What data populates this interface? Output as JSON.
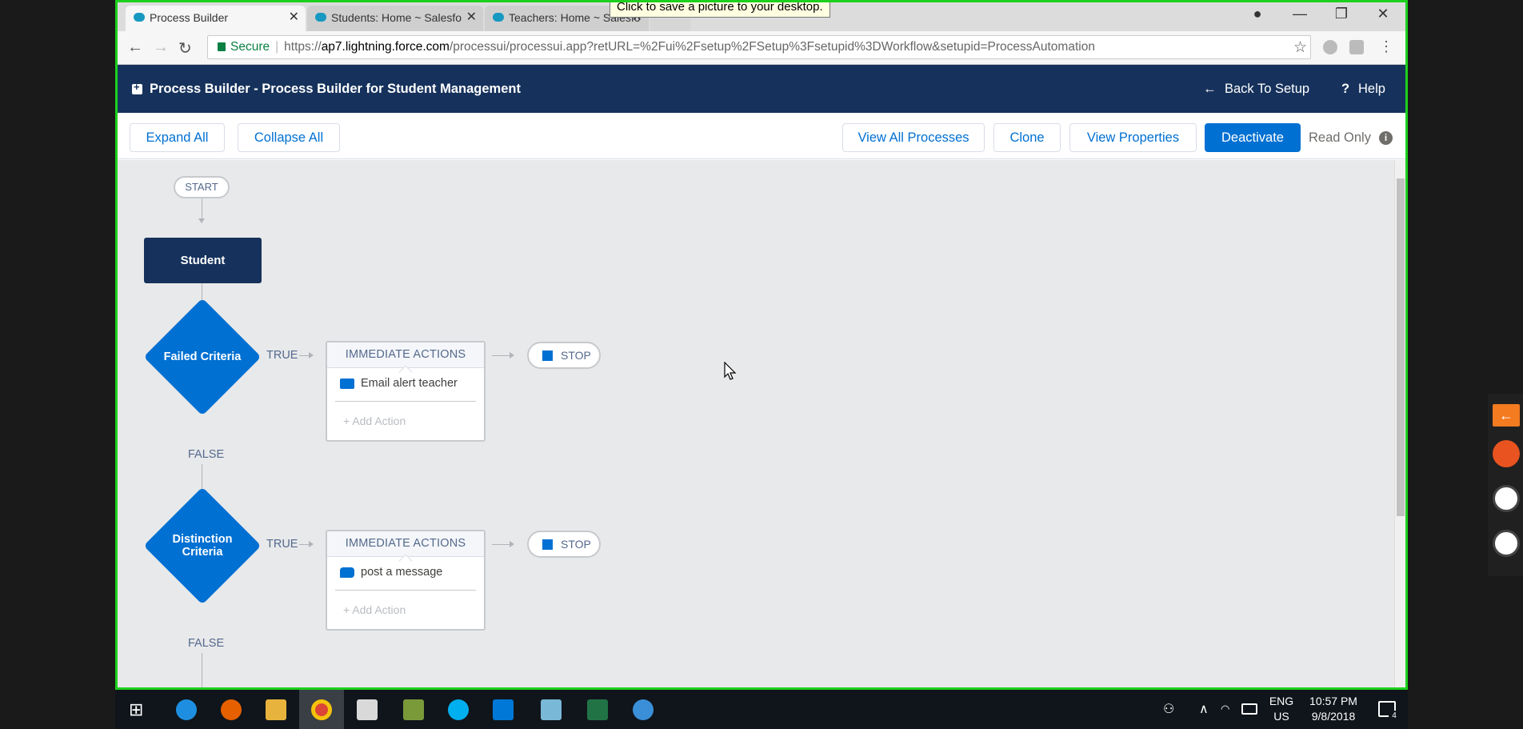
{
  "browser": {
    "tabs": [
      {
        "title": "Process Builder",
        "active": true
      },
      {
        "title": "Students: Home ~ Salesfo",
        "active": false
      },
      {
        "title": "Teachers: Home ~ Salesfo",
        "active": false
      }
    ],
    "tooltip": "Click to save a picture to your desktop.",
    "secure_label": "Secure",
    "url_scheme": "https://",
    "url_domain": "ap7.lightning.force.com",
    "url_path": "/processui/processui.app?retURL=%2Fui%2Fsetup%2FSetup%3Fsetupid%3DWorkflow&setupid=ProcessAutomation"
  },
  "header": {
    "title": "Process Builder - Process Builder for Student Management",
    "back_to_setup": "Back To Setup",
    "help": "Help"
  },
  "toolbar": {
    "expand_all": "Expand All",
    "collapse_all": "Collapse All",
    "view_all_processes": "View All Processes",
    "clone": "Clone",
    "view_properties": "View Properties",
    "deactivate": "Deactivate",
    "read_only": "Read Only"
  },
  "canvas": {
    "start": "START",
    "object_node": "Student",
    "criteria": [
      {
        "name": "Failed Criteria",
        "true_label": "TRUE",
        "false_label": "FALSE",
        "actions_header": "IMMEDIATE ACTIONS",
        "action": "Email alert teacher",
        "action_icon": "email-icon",
        "add_action": "Add Action",
        "stop": "STOP"
      },
      {
        "name": "Distinction Criteria",
        "true_label": "TRUE",
        "false_label": "FALSE",
        "actions_header": "IMMEDIATE ACTIONS",
        "action": "post a message",
        "action_icon": "chat-bubble-icon",
        "add_action": "Add Action",
        "stop": "STOP"
      }
    ]
  },
  "taskbar": {
    "lang_top": "ENG",
    "lang_bottom": "US",
    "time": "10:57 PM",
    "date": "9/8/2018",
    "notification_count": "4"
  },
  "colors": {
    "sf_navy": "#16325c",
    "sf_blue": "#0070d2",
    "highlight_border": "#1dd01d",
    "canvas_bg": "#e8e9eb"
  }
}
